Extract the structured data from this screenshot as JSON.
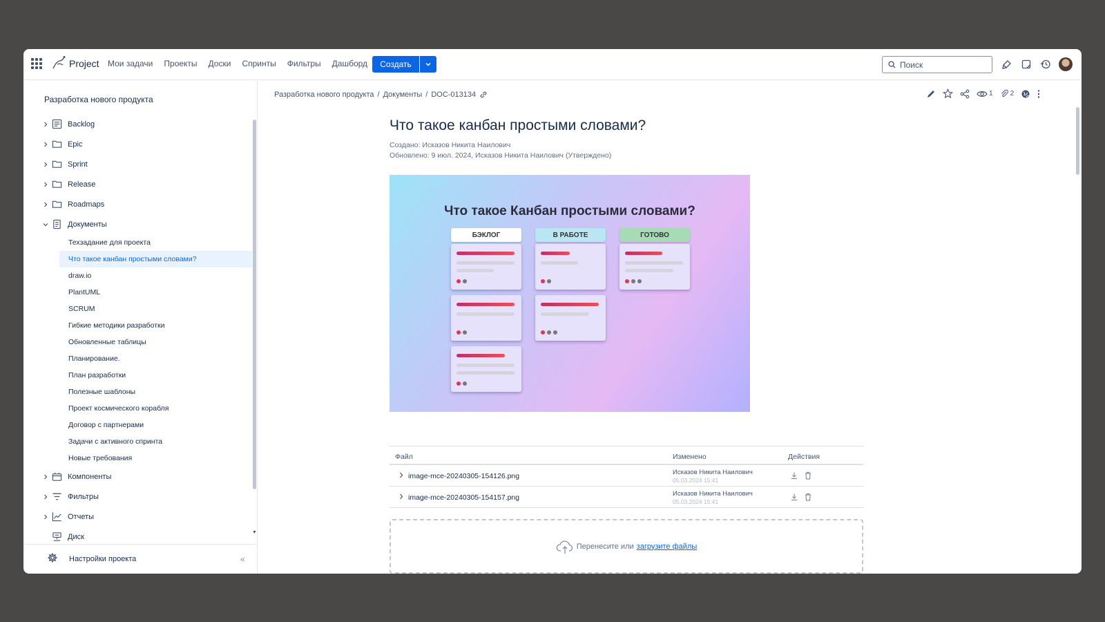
{
  "header": {
    "brand": "Project",
    "nav": [
      "Мои задачи",
      "Проекты",
      "Доски",
      "Спринты",
      "Фильтры",
      "Дашборд"
    ],
    "create_label": "Создать",
    "search_placeholder": "Поиск"
  },
  "sidebar": {
    "project_title": "Разработка нового продукта",
    "items": [
      {
        "label": "Backlog"
      },
      {
        "label": "Epic"
      },
      {
        "label": "Sprint"
      },
      {
        "label": "Release"
      },
      {
        "label": "Roadmaps"
      },
      {
        "label": "Документы"
      }
    ],
    "documents": [
      "Техзадание для проекта",
      "Что такое канбан простыми словами?",
      "draw.io",
      "PlantUML",
      "SCRUM",
      "Гибкие методики разработки",
      "Обновленные таблицы",
      "Планирование.",
      "План разработки",
      "Полезные шаблоны",
      "Проект космического корабля",
      "Договор с партнерами",
      "Задачи с активного спринта",
      "Новые требования"
    ],
    "items_after": [
      {
        "label": "Компоненты"
      },
      {
        "label": "Фильтры"
      },
      {
        "label": "Отчеты"
      },
      {
        "label": "Диск"
      }
    ],
    "settings_label": "Настройки проекта",
    "collapse_label": "«"
  },
  "breadcrumb": [
    "Разработка нового продукта",
    "Документы",
    "DOC-013134"
  ],
  "breadcrumb_sep": "/",
  "actions": {
    "watchers": "1",
    "attachments": "2"
  },
  "document": {
    "title": "Что такое канбан простыми словами?",
    "created": "Создано: Исказов Никита Наилович",
    "updated": "Обновлено: 9 июл. 2024, Исказов Никита Наилович  (Утверждено)"
  },
  "banner": {
    "title": "Что такое Канбан простыми словами?",
    "columns": [
      {
        "label": "БЭКЛОГ",
        "color": "#ffffff"
      },
      {
        "label": "В РАБОТЕ",
        "color": "#b9e6f2"
      },
      {
        "label": "ГОТОВО",
        "color": "#a6dbb6"
      }
    ]
  },
  "files": {
    "headers": [
      "Файл",
      "Изменено",
      "Действия"
    ],
    "rows": [
      {
        "name": "image-mce-20240305-154126.png",
        "author": "Исказов Никита Наилович",
        "date": "05.03.2024 15:41"
      },
      {
        "name": "image-mce-20240305-154157.png",
        "author": "Исказов Никита Наилович",
        "date": "05.03.2024 15:41"
      }
    ]
  },
  "dropzone": {
    "text": "Перенесите или",
    "link": "загрузите файлы"
  },
  "colors": {
    "accent": "#0c66e4",
    "active_bg": "#e9f2ff"
  }
}
